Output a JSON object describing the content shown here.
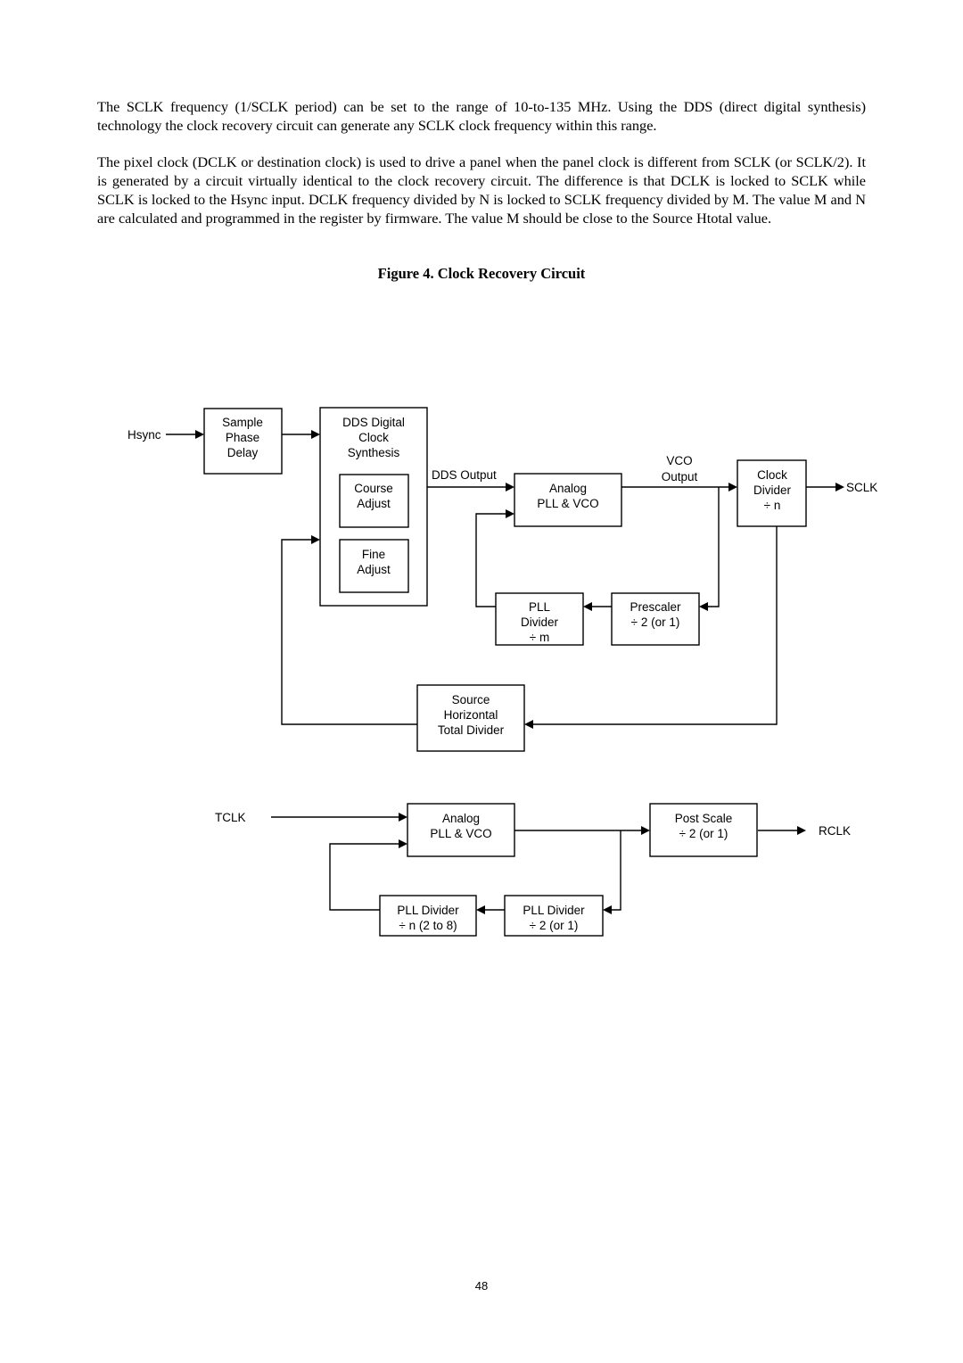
{
  "document": {
    "paragraphs": [
      "The SCLK frequency (1/SCLK period) can be set to the range of 10-to-135 MHz. Using the DDS (direct digital synthesis) technology the clock recovery circuit can generate any SCLK clock frequency within this range.",
      "The pixel clock (DCLK or destination clock) is used to drive a panel when the panel clock is different from SCLK (or SCLK/2). It is generated by a circuit virtually identical to the clock recovery circuit. The difference is that DCLK is locked to SCLK while SCLK is locked to the Hsync input. DCLK frequency divided by N is locked to SCLK frequency divided by M. The value M and N are calculated and programmed in the register by firmware. The value M should be close to the Source Htotal value."
    ],
    "figure_caption": "Figure 4. Clock Recovery Circuit",
    "page_number": "48"
  },
  "diagram": {
    "clock_recovery": {
      "signals": {
        "hsync": "Hsync",
        "dds_output": "DDS Output",
        "vco_output": [
          "VCO",
          "Output"
        ],
        "sclk": "SCLK"
      },
      "blocks": {
        "sample_phase_delay": [
          "Sample",
          "Phase",
          "Delay"
        ],
        "dds_digital_clock_synthesis": [
          "DDS Digital",
          "Clock",
          "Synthesis"
        ],
        "course_adjust": [
          "Course",
          "Adjust"
        ],
        "fine_adjust": [
          "Fine",
          "Adjust"
        ],
        "analog_pll_vco": [
          "Analog",
          "PLL & VCO"
        ],
        "clock_divider": [
          "Clock",
          "Divider",
          "÷ n"
        ],
        "pll_divider_m": [
          "PLL",
          "Divider",
          "÷ m"
        ],
        "prescaler": [
          "Prescaler",
          "÷ 2 (or 1)"
        ],
        "source_htotal_divider": [
          "Source",
          "Horizontal",
          "Total Divider"
        ]
      }
    },
    "rclk_pll": {
      "signals": {
        "tclk": "TCLK",
        "rclk": "RCLK"
      },
      "blocks": {
        "analog_pll_vco": [
          "Analog",
          "PLL & VCO"
        ],
        "post_scale": [
          "Post Scale",
          "÷ 2 (or 1)"
        ],
        "pll_divider_n": [
          "PLL Divider",
          "÷ n (2 to 8)"
        ],
        "pll_divider_2": [
          "PLL Divider",
          "÷ 2 (or 1)"
        ]
      }
    }
  }
}
